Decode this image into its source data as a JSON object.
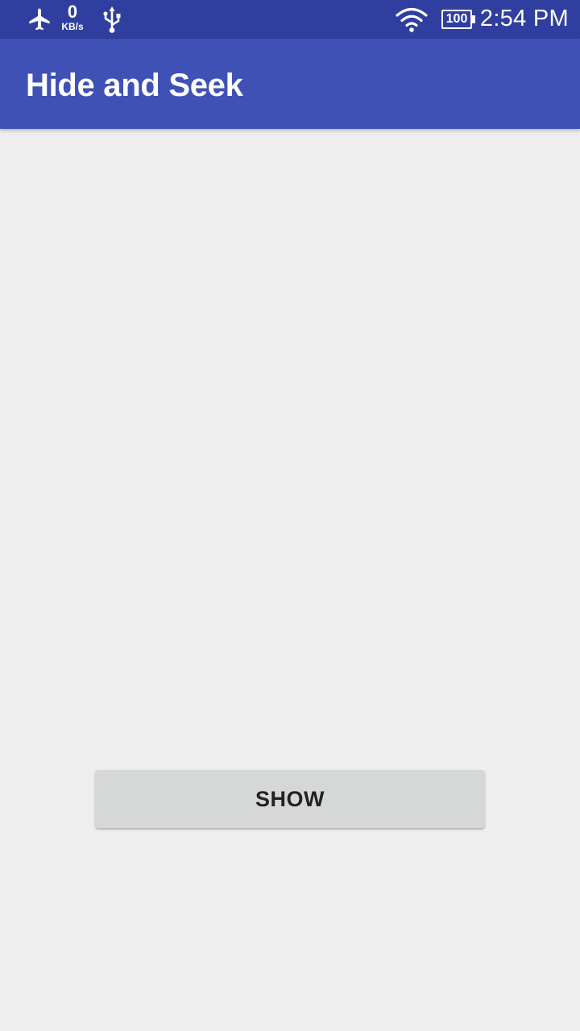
{
  "status_bar": {
    "airplane_icon": "airplane-icon",
    "net_speed_value": "0",
    "net_speed_unit": "KB/s",
    "usb_icon": "usb-icon",
    "wifi_icon": "wifi-icon",
    "battery_level": "100",
    "time": "2:54 PM",
    "background_color": "#303f9f"
  },
  "app_bar": {
    "title": "Hide and Seek",
    "background_color": "#3f51b5"
  },
  "main": {
    "background_color": "#eeeeee",
    "show_button_label": "SHOW"
  }
}
